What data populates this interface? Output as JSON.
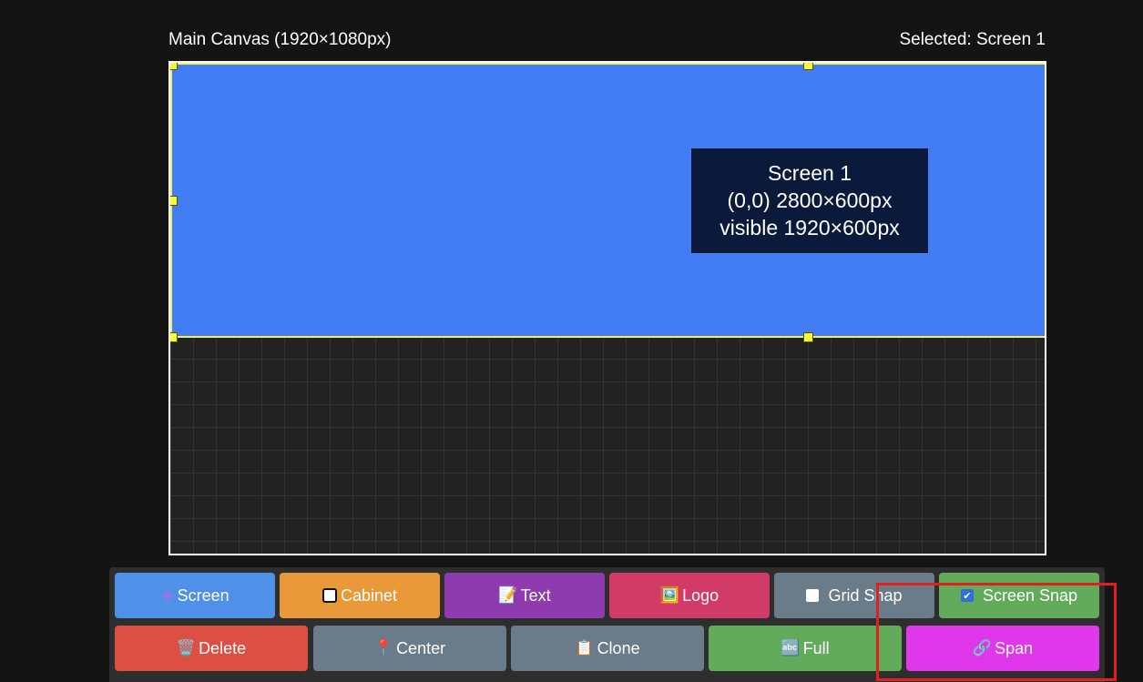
{
  "header": {
    "canvas_title": "Main Canvas (1920×1080px)",
    "selected_label": "Selected: Screen 1"
  },
  "canvas": {
    "screen": {
      "name": "Screen 1",
      "position_size": "(0,0) 2800×600px",
      "visible": "visible 1920×600px"
    }
  },
  "toolbar": {
    "row1": [
      {
        "label": "Screen",
        "icon": "plus-icon"
      },
      {
        "label": "Cabinet",
        "icon": "square-icon"
      },
      {
        "label": "Text",
        "icon": "memo-icon"
      },
      {
        "label": "Logo",
        "icon": "picture-icon"
      },
      {
        "label": "Grid Snap",
        "icon": "checkbox-icon",
        "checked": false
      },
      {
        "label": "Screen Snap",
        "icon": "checkbox-icon",
        "checked": true
      }
    ],
    "row2": [
      {
        "label": "Delete",
        "icon": "wastebasket-icon"
      },
      {
        "label": "Center",
        "icon": "pushpin-icon"
      },
      {
        "label": "Clone",
        "icon": "clipboard-icon"
      },
      {
        "label": "Full",
        "icon": "abc-icon"
      },
      {
        "label": "Span",
        "icon": "link-icon"
      }
    ]
  },
  "colors": {
    "screen_fill": "#437df5",
    "selection_border": "#f5f05a",
    "highlight_box": "#e0201e"
  }
}
